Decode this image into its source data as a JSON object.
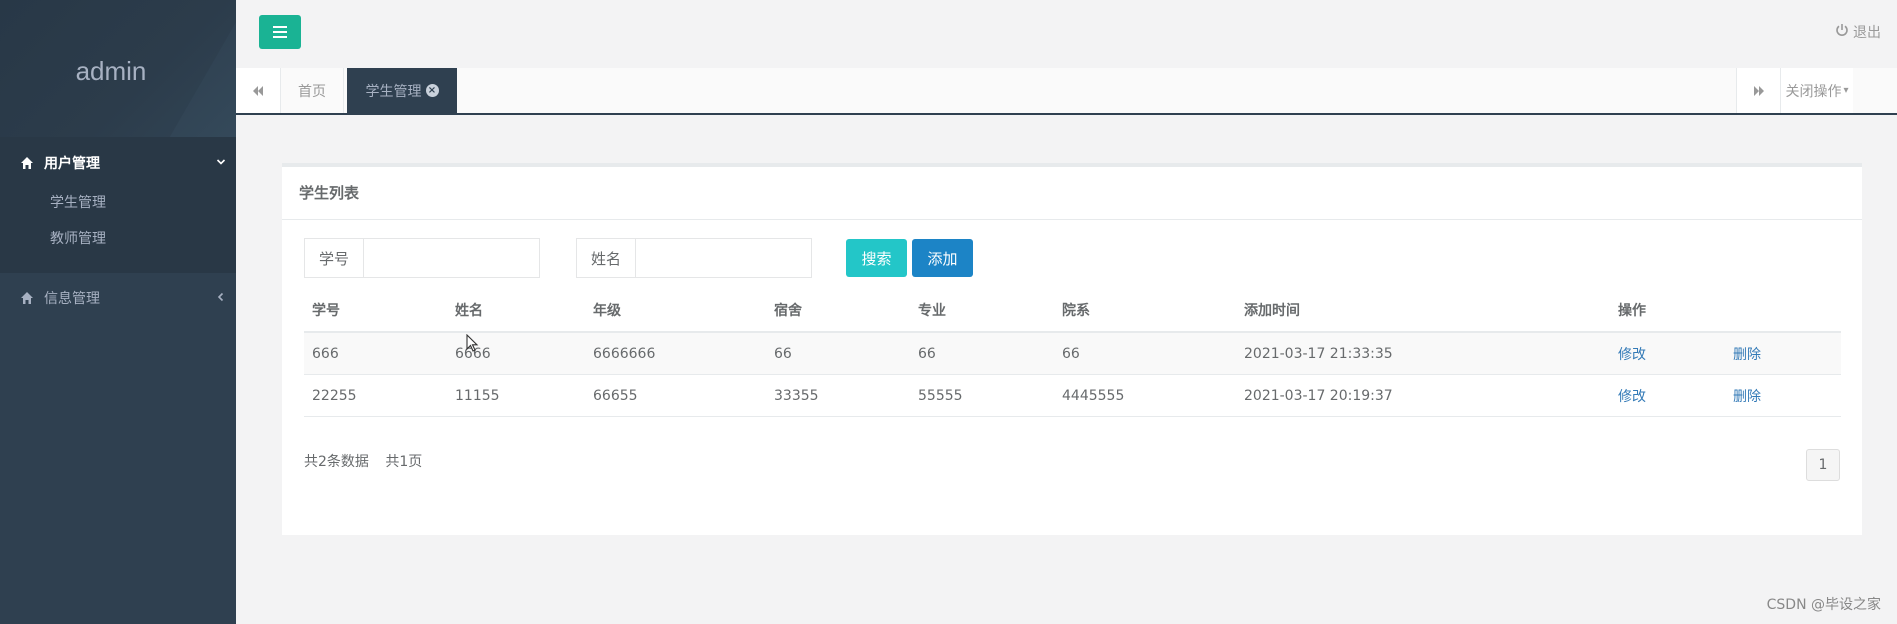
{
  "sidebar": {
    "username": "admin",
    "groups": [
      {
        "label": "用户管理",
        "items": [
          {
            "label": "学生管理"
          },
          {
            "label": "教师管理"
          }
        ]
      },
      {
        "label": "信息管理"
      }
    ]
  },
  "topbar": {
    "logout_label": "退出"
  },
  "tabs": {
    "home_label": "首页",
    "active_label": "学生管理",
    "close_ops_label": "关闭操作"
  },
  "panel": {
    "title": "学生列表",
    "search": {
      "id_label": "学号",
      "id_value": "",
      "name_label": "姓名",
      "name_value": "",
      "search_button": "搜索",
      "add_button": "添加"
    },
    "table": {
      "headers": [
        "学号",
        "姓名",
        "年级",
        "宿舍",
        "专业",
        "院系",
        "添加时间",
        "操作"
      ],
      "rows": [
        {
          "id": "666",
          "name": "6666",
          "grade": "6666666",
          "dorm": "66",
          "major": "66",
          "dept": "66",
          "time": "2021-03-17 21:33:35",
          "edit": "修改",
          "delete": "删除"
        },
        {
          "id": "22255",
          "name": "11155",
          "grade": "66655",
          "dorm": "33355",
          "major": "55555",
          "dept": "4445555",
          "time": "2021-03-17 20:19:37",
          "edit": "修改",
          "delete": "删除"
        }
      ]
    },
    "footer": {
      "total_text": "共2条数据",
      "pages_text": "共1页",
      "current_page": "1"
    }
  },
  "watermark": "CSDN @毕设之家",
  "colors": {
    "sidebar": "#2f4050",
    "primary": "#1ab394",
    "info": "#23c6c8",
    "success": "#1c84c6",
    "link": "#337ab7"
  }
}
